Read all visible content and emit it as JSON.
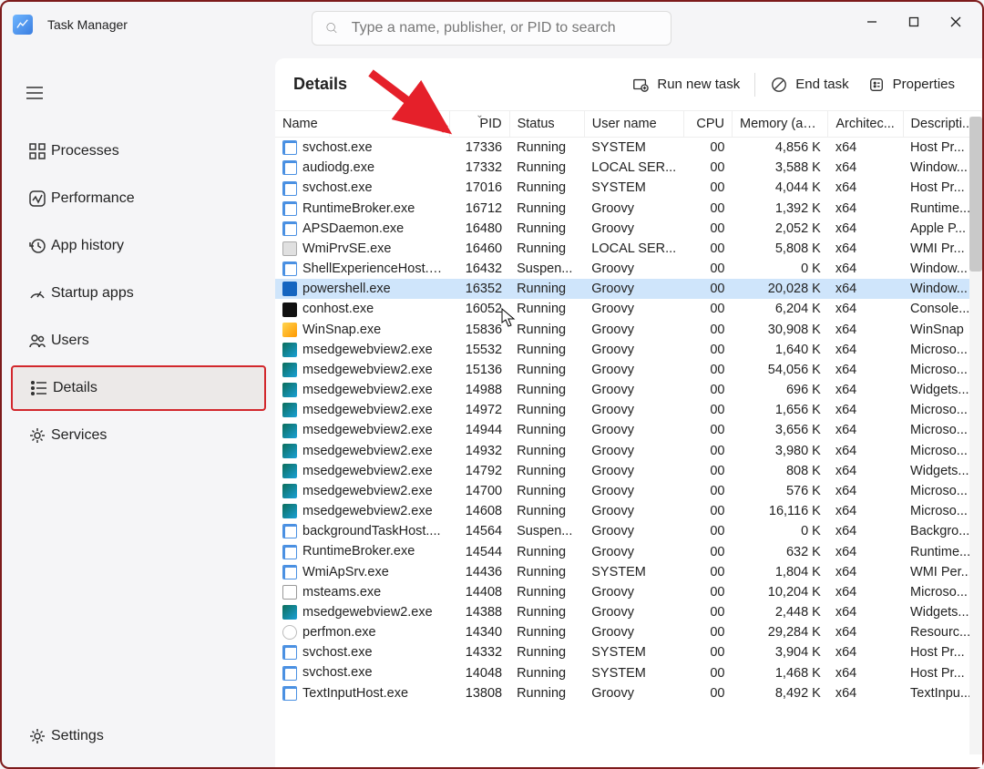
{
  "app": {
    "title": "Task Manager"
  },
  "search": {
    "placeholder": "Type a name, publisher, or PID to search"
  },
  "window_controls": {
    "min": "minimize",
    "max": "maximize",
    "close": "close"
  },
  "sidebar": {
    "items": [
      {
        "key": "processes",
        "label": "Processes"
      },
      {
        "key": "performance",
        "label": "Performance"
      },
      {
        "key": "apphistory",
        "label": "App history"
      },
      {
        "key": "startup",
        "label": "Startup apps"
      },
      {
        "key": "users",
        "label": "Users"
      },
      {
        "key": "details",
        "label": "Details",
        "active": true
      },
      {
        "key": "services",
        "label": "Services"
      }
    ],
    "settings": "Settings"
  },
  "toolbar": {
    "page_title": "Details",
    "run_task": "Run new task",
    "end_task": "End task",
    "properties": "Properties"
  },
  "columns": {
    "name": "Name",
    "pid": "PID",
    "status": "Status",
    "user": "User name",
    "cpu": "CPU",
    "memory": "Memory (ac...",
    "arch": "Architec...",
    "desc": "Descripti..."
  },
  "sort": {
    "column": "pid",
    "dir": "desc"
  },
  "rows": [
    {
      "icon": "svc",
      "name": "svchost.exe",
      "pid": "17336",
      "status": "Running",
      "user": "SYSTEM",
      "cpu": "00",
      "mem": "4,856 K",
      "arch": "x64",
      "desc": "Host Pr..."
    },
    {
      "icon": "svc",
      "name": "audiodg.exe",
      "pid": "17332",
      "status": "Running",
      "user": "LOCAL SER...",
      "cpu": "00",
      "mem": "3,588 K",
      "arch": "x64",
      "desc": "Window..."
    },
    {
      "icon": "svc",
      "name": "svchost.exe",
      "pid": "17016",
      "status": "Running",
      "user": "SYSTEM",
      "cpu": "00",
      "mem": "4,044 K",
      "arch": "x64",
      "desc": "Host Pr..."
    },
    {
      "icon": "svc",
      "name": "RuntimeBroker.exe",
      "pid": "16712",
      "status": "Running",
      "user": "Groovy",
      "cpu": "00",
      "mem": "1,392 K",
      "arch": "x64",
      "desc": "Runtime..."
    },
    {
      "icon": "svc",
      "name": "APSDaemon.exe",
      "pid": "16480",
      "status": "Running",
      "user": "Groovy",
      "cpu": "00",
      "mem": "2,052 K",
      "arch": "x64",
      "desc": "Apple P..."
    },
    {
      "icon": "wmi",
      "name": "WmiPrvSE.exe",
      "pid": "16460",
      "status": "Running",
      "user": "LOCAL SER...",
      "cpu": "00",
      "mem": "5,808 K",
      "arch": "x64",
      "desc": "WMI Pr..."
    },
    {
      "icon": "svc",
      "name": "ShellExperienceHost.e...",
      "pid": "16432",
      "status": "Suspen...",
      "user": "Groovy",
      "cpu": "00",
      "mem": "0 K",
      "arch": "x64",
      "desc": "Window..."
    },
    {
      "icon": "ps",
      "name": "powershell.exe",
      "pid": "16352",
      "status": "Running",
      "user": "Groovy",
      "cpu": "00",
      "mem": "20,028 K",
      "arch": "x64",
      "desc": "Window...",
      "selected": true
    },
    {
      "icon": "con",
      "name": "conhost.exe",
      "pid": "16052",
      "status": "Running",
      "user": "Groovy",
      "cpu": "00",
      "mem": "6,204 K",
      "arch": "x64",
      "desc": "Console..."
    },
    {
      "icon": "winsnap",
      "name": "WinSnap.exe",
      "pid": "15836",
      "status": "Running",
      "user": "Groovy",
      "cpu": "00",
      "mem": "30,908 K",
      "arch": "x64",
      "desc": "WinSnap"
    },
    {
      "icon": "edge",
      "name": "msedgewebview2.exe",
      "pid": "15532",
      "status": "Running",
      "user": "Groovy",
      "cpu": "00",
      "mem": "1,640 K",
      "arch": "x64",
      "desc": "Microso..."
    },
    {
      "icon": "edge",
      "name": "msedgewebview2.exe",
      "pid": "15136",
      "status": "Running",
      "user": "Groovy",
      "cpu": "00",
      "mem": "54,056 K",
      "arch": "x64",
      "desc": "Microso..."
    },
    {
      "icon": "edge",
      "name": "msedgewebview2.exe",
      "pid": "14988",
      "status": "Running",
      "user": "Groovy",
      "cpu": "00",
      "mem": "696 K",
      "arch": "x64",
      "desc": "Widgets..."
    },
    {
      "icon": "edge",
      "name": "msedgewebview2.exe",
      "pid": "14972",
      "status": "Running",
      "user": "Groovy",
      "cpu": "00",
      "mem": "1,656 K",
      "arch": "x64",
      "desc": "Microso..."
    },
    {
      "icon": "edge",
      "name": "msedgewebview2.exe",
      "pid": "14944",
      "status": "Running",
      "user": "Groovy",
      "cpu": "00",
      "mem": "3,656 K",
      "arch": "x64",
      "desc": "Microso..."
    },
    {
      "icon": "edge",
      "name": "msedgewebview2.exe",
      "pid": "14932",
      "status": "Running",
      "user": "Groovy",
      "cpu": "00",
      "mem": "3,980 K",
      "arch": "x64",
      "desc": "Microso..."
    },
    {
      "icon": "edge",
      "name": "msedgewebview2.exe",
      "pid": "14792",
      "status": "Running",
      "user": "Groovy",
      "cpu": "00",
      "mem": "808 K",
      "arch": "x64",
      "desc": "Widgets..."
    },
    {
      "icon": "edge",
      "name": "msedgewebview2.exe",
      "pid": "14700",
      "status": "Running",
      "user": "Groovy",
      "cpu": "00",
      "mem": "576 K",
      "arch": "x64",
      "desc": "Microso..."
    },
    {
      "icon": "edge",
      "name": "msedgewebview2.exe",
      "pid": "14608",
      "status": "Running",
      "user": "Groovy",
      "cpu": "00",
      "mem": "16,116 K",
      "arch": "x64",
      "desc": "Microso..."
    },
    {
      "icon": "svc",
      "name": "backgroundTaskHost....",
      "pid": "14564",
      "status": "Suspen...",
      "user": "Groovy",
      "cpu": "00",
      "mem": "0 K",
      "arch": "x64",
      "desc": "Backgro..."
    },
    {
      "icon": "svc",
      "name": "RuntimeBroker.exe",
      "pid": "14544",
      "status": "Running",
      "user": "Groovy",
      "cpu": "00",
      "mem": "632 K",
      "arch": "x64",
      "desc": "Runtime..."
    },
    {
      "icon": "svc",
      "name": "WmiApSrv.exe",
      "pid": "14436",
      "status": "Running",
      "user": "SYSTEM",
      "cpu": "00",
      "mem": "1,804 K",
      "arch": "x64",
      "desc": "WMI Per..."
    },
    {
      "icon": "teams",
      "name": "msteams.exe",
      "pid": "14408",
      "status": "Running",
      "user": "Groovy",
      "cpu": "00",
      "mem": "10,204 K",
      "arch": "x64",
      "desc": "Microso..."
    },
    {
      "icon": "edge",
      "name": "msedgewebview2.exe",
      "pid": "14388",
      "status": "Running",
      "user": "Groovy",
      "cpu": "00",
      "mem": "2,448 K",
      "arch": "x64",
      "desc": "Widgets..."
    },
    {
      "icon": "perf",
      "name": "perfmon.exe",
      "pid": "14340",
      "status": "Running",
      "user": "Groovy",
      "cpu": "00",
      "mem": "29,284 K",
      "arch": "x64",
      "desc": "Resourc..."
    },
    {
      "icon": "svc",
      "name": "svchost.exe",
      "pid": "14332",
      "status": "Running",
      "user": "SYSTEM",
      "cpu": "00",
      "mem": "3,904 K",
      "arch": "x64",
      "desc": "Host Pr..."
    },
    {
      "icon": "svc",
      "name": "svchost.exe",
      "pid": "14048",
      "status": "Running",
      "user": "SYSTEM",
      "cpu": "00",
      "mem": "1,468 K",
      "arch": "x64",
      "desc": "Host Pr..."
    },
    {
      "icon": "svc",
      "name": "TextInputHost.exe",
      "pid": "13808",
      "status": "Running",
      "user": "Groovy",
      "cpu": "00",
      "mem": "8,492 K",
      "arch": "x64",
      "desc": "TextInpu..."
    }
  ]
}
